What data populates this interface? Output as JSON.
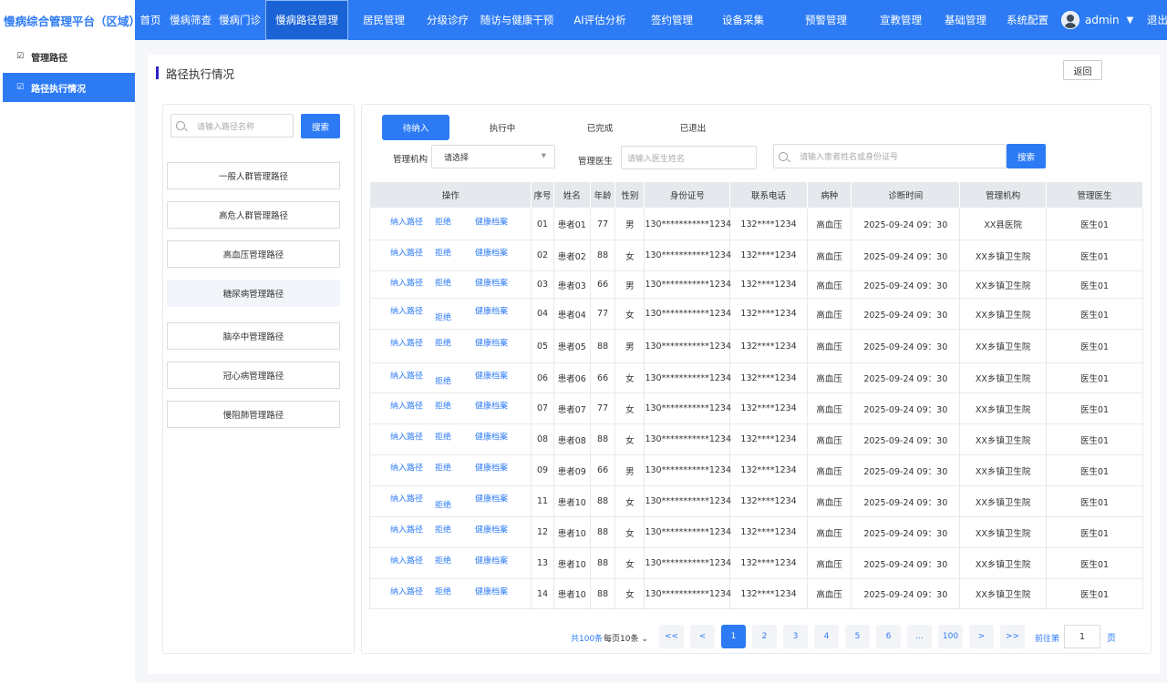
{
  "app": {
    "title": "慢病综合管理平台（区域）"
  },
  "topnav": [
    {
      "label": "首页"
    },
    {
      "label": "慢病筛查"
    },
    {
      "label": "慢病门诊"
    },
    {
      "label": "慢病路径管理"
    },
    {
      "label": "居民管理"
    },
    {
      "label": "分级诊疗"
    },
    {
      "label": "随访与健康干预"
    },
    {
      "label": "AI评估分析"
    },
    {
      "label": "签约管理"
    },
    {
      "label": "设备采集"
    },
    {
      "label": "预警管理"
    },
    {
      "label": "宣教管理"
    },
    {
      "label": "基础管理"
    },
    {
      "label": "系统配置"
    }
  ],
  "user": {
    "name": "admin",
    "logout": "退出"
  },
  "sidemenu": [
    {
      "label": "管理路径"
    },
    {
      "label": "路径执行情况"
    }
  ],
  "page": {
    "title": "路径执行情况",
    "back": "返回"
  },
  "left": {
    "search_placeholder": "请输入路径名称",
    "search_button": "搜索",
    "paths": [
      {
        "label": "一般人群管理路径"
      },
      {
        "label": "高危人群管理路径"
      },
      {
        "label": "高血压管理路径"
      },
      {
        "label": "糖尿病管理路径"
      },
      {
        "label": "脑卒中管理路径"
      },
      {
        "label": "冠心病管理路径"
      },
      {
        "label": "慢阻肺管理路径"
      }
    ]
  },
  "tabs": [
    {
      "label": "待纳入"
    },
    {
      "label": "执行中"
    },
    {
      "label": "已完成"
    },
    {
      "label": "已退出"
    }
  ],
  "filters": {
    "org_label": "管理机构",
    "org_value": "请选择",
    "doctor_label": "管理医生",
    "doctor_placeholder": "请输入医生姓名",
    "patient_placeholder": "请输入患者姓名或身份证号",
    "search_button": "搜索"
  },
  "table": {
    "headers": [
      "操作",
      "序号",
      "姓名",
      "年龄",
      "性别",
      "身份证号",
      "联系电话",
      "病种",
      "诊断时间",
      "管理机构",
      "管理医生"
    ],
    "actions": [
      "纳入路径",
      "拒绝",
      "健康档案"
    ],
    "rows": [
      {
        "no": "01",
        "name": "患者01",
        "age": "77",
        "sex": "男",
        "id": "130***********1234",
        "phone": "132****1234",
        "disease": "高血压",
        "time": "2025-09-24  09：30",
        "org": "XX县医院",
        "doctor": "医生01"
      },
      {
        "no": "02",
        "name": "患者02",
        "age": "88",
        "sex": "女",
        "id": "130***********1234",
        "phone": "132****1234",
        "disease": "高血压",
        "time": "2025-09-24  09：30",
        "org": "XX乡镇卫生院",
        "doctor": "医生01"
      },
      {
        "no": "03",
        "name": "患者03",
        "age": "66",
        "sex": "男",
        "id": "130***********1234",
        "phone": "132****1234",
        "disease": "高血压",
        "time": "2025-09-24  09：30",
        "org": "XX乡镇卫生院",
        "doctor": "医生01"
      },
      {
        "no": "04",
        "name": "患者04",
        "age": "77",
        "sex": "女",
        "id": "130***********1234",
        "phone": "132****1234",
        "disease": "高血压",
        "time": "2025-09-24  09：30",
        "org": "XX乡镇卫生院",
        "doctor": "医生01"
      },
      {
        "no": "05",
        "name": "患者05",
        "age": "88",
        "sex": "男",
        "id": "130***********1234",
        "phone": "132****1234",
        "disease": "高血压",
        "time": "2025-09-24  09：30",
        "org": "XX乡镇卫生院",
        "doctor": "医生01"
      },
      {
        "no": "06",
        "name": "患者06",
        "age": "66",
        "sex": "女",
        "id": "130***********1234",
        "phone": "132****1234",
        "disease": "高血压",
        "time": "2025-09-24  09：30",
        "org": "XX乡镇卫生院",
        "doctor": "医生01"
      },
      {
        "no": "07",
        "name": "患者07",
        "age": "77",
        "sex": "女",
        "id": "130***********1234",
        "phone": "132****1234",
        "disease": "高血压",
        "time": "2025-09-24  09：30",
        "org": "XX乡镇卫生院",
        "doctor": "医生01"
      },
      {
        "no": "08",
        "name": "患者08",
        "age": "88",
        "sex": "女",
        "id": "130***********1234",
        "phone": "132****1234",
        "disease": "高血压",
        "time": "2025-09-24  09：30",
        "org": "XX乡镇卫生院",
        "doctor": "医生01"
      },
      {
        "no": "09",
        "name": "患者09",
        "age": "66",
        "sex": "男",
        "id": "130***********1234",
        "phone": "132****1234",
        "disease": "高血压",
        "time": "2025-09-24  09：30",
        "org": "XX乡镇卫生院",
        "doctor": "医生01"
      },
      {
        "no": "11",
        "name": "患者10",
        "age": "88",
        "sex": "女",
        "id": "130***********1234",
        "phone": "132****1234",
        "disease": "高血压",
        "time": "2025-09-24  09：30",
        "org": "XX乡镇卫生院",
        "doctor": "医生01"
      },
      {
        "no": "12",
        "name": "患者10",
        "age": "88",
        "sex": "女",
        "id": "130***********1234",
        "phone": "132****1234",
        "disease": "高血压",
        "time": "2025-09-24  09：30",
        "org": "XX乡镇卫生院",
        "doctor": "医生01"
      },
      {
        "no": "13",
        "name": "患者10",
        "age": "88",
        "sex": "女",
        "id": "130***********1234",
        "phone": "132****1234",
        "disease": "高血压",
        "time": "2025-09-24  09：30",
        "org": "XX乡镇卫生院",
        "doctor": "医生01"
      },
      {
        "no": "14",
        "name": "患者10",
        "age": "88",
        "sex": "女",
        "id": "130***********1234",
        "phone": "132****1234",
        "disease": "高血压",
        "time": "2025-09-24  09：30",
        "org": "XX乡镇卫生院",
        "doctor": "医生01"
      }
    ]
  },
  "pagination": {
    "total": "共100条",
    "page_size": "每页10条 ⌄",
    "first": "<<",
    "prev": "<",
    "pages": [
      "1",
      "2",
      "3",
      "4",
      "5",
      "6",
      "...",
      "100"
    ],
    "next": ">",
    "last": ">>",
    "goto": "前往第",
    "goto_value": "1",
    "page_suffix": "页"
  }
}
